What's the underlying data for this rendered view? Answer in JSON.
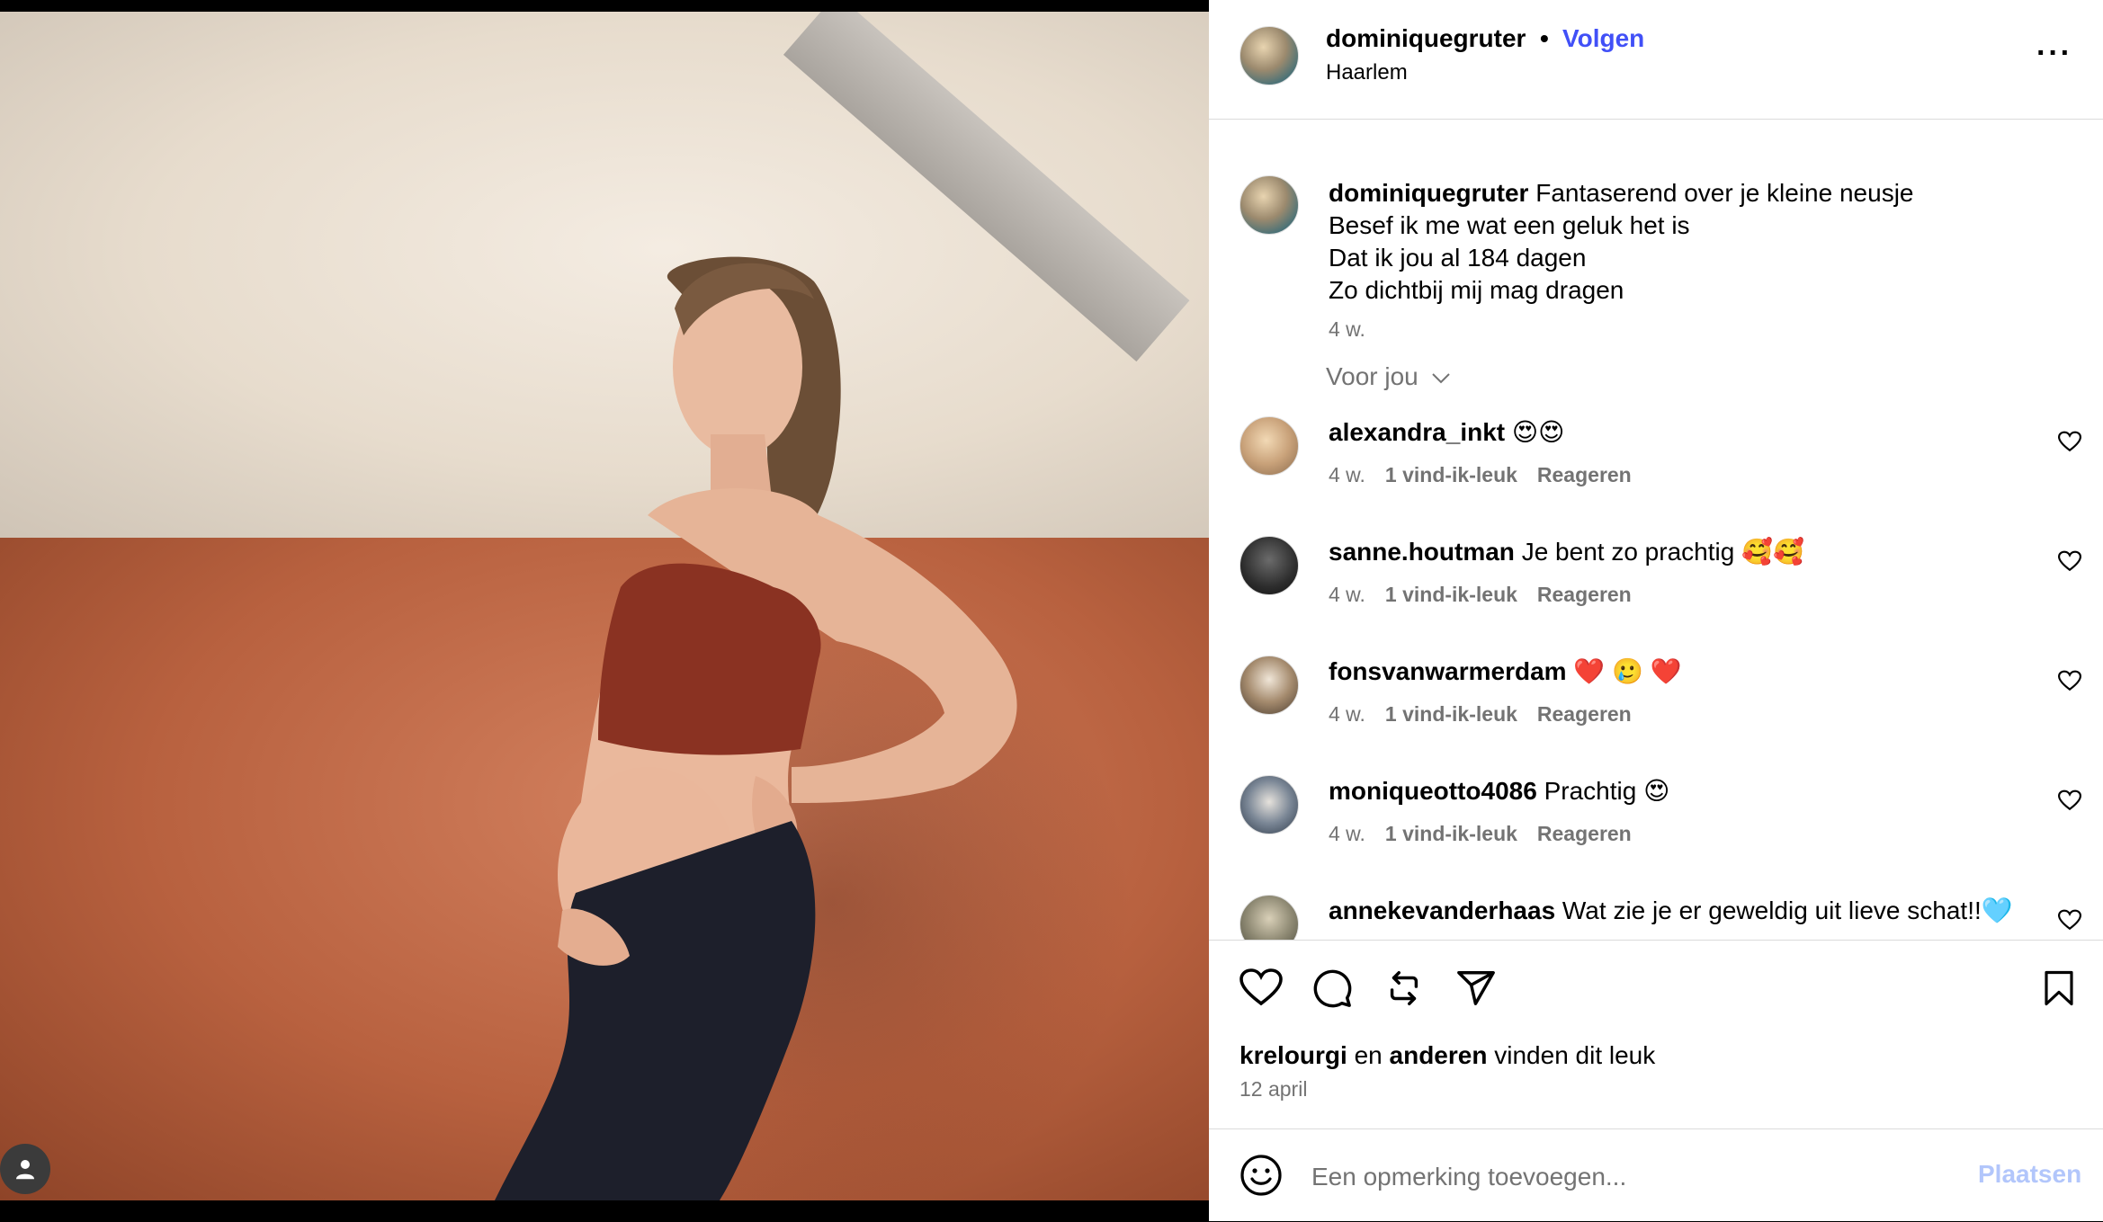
{
  "post": {
    "username": "dominiquegruter",
    "separator": "•",
    "follow_label": "Volgen",
    "location": "Haarlem",
    "more_label": "···"
  },
  "caption": {
    "username": "dominiquegruter",
    "lines": [
      "Fantaserend over je kleine neusje",
      "Besef ik me wat een geluk het is",
      "Dat ik jou al 184 dagen",
      "Zo dichtbij mij mag dragen"
    ],
    "time": "4 w."
  },
  "filter": {
    "label": "Voor jou"
  },
  "comments": [
    {
      "username": "alexandra_inkt",
      "text": "😍😍",
      "time": "4 w.",
      "likes": "1 vind-ik-leuk",
      "reply": "Reageren"
    },
    {
      "username": "sanne.houtman",
      "text": "Je bent zo prachtig 🥰🥰",
      "time": "4 w.",
      "likes": "1 vind-ik-leuk",
      "reply": "Reageren"
    },
    {
      "username": "fonsvanwarmerdam",
      "text": "❤️ 🥲 ❤️",
      "time": "4 w.",
      "likes": "1 vind-ik-leuk",
      "reply": "Reageren"
    },
    {
      "username": "moniqueotto4086",
      "text": "Prachtig 😍",
      "time": "4 w.",
      "likes": "1 vind-ik-leuk",
      "reply": "Reageren"
    },
    {
      "username": "annekevanderhaas",
      "text": "Wat zie je er geweldig uit lieve schat!!🩵",
      "time": "",
      "likes": "",
      "reply": ""
    }
  ],
  "likes_line": {
    "user": "krelourgi",
    "and": "en",
    "others": "anderen",
    "suffix": "vinden dit leuk"
  },
  "post_date": "12 april",
  "add_comment": {
    "placeholder": "Een opmerking toevoegen...",
    "post_label": "Plaatsen"
  },
  "colors": {
    "accent": "#4150f7",
    "muted": "#737373",
    "post_disabled": "#b2c6fb"
  }
}
